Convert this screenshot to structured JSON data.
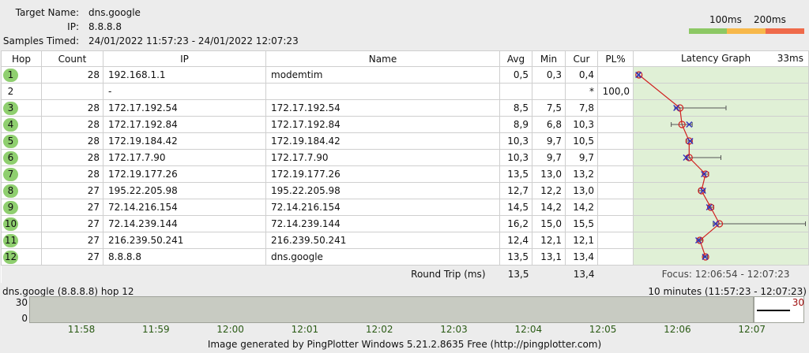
{
  "header": {
    "target_label": "Target Name:",
    "target_value": "dns.google",
    "ip_label": "IP:",
    "ip_value": "8.8.8.8",
    "samples_label": "Samples Timed:",
    "samples_value": "24/01/2022 11:57:23 - 24/01/2022 12:07:23"
  },
  "scale": {
    "label_100": "100ms",
    "label_200": "200ms",
    "colors": [
      "#8cc864",
      "#f7b84a",
      "#ef6a4a"
    ]
  },
  "columns": {
    "hop": "Hop",
    "count": "Count",
    "ip": "IP",
    "name": "Name",
    "avg": "Avg",
    "min": "Min",
    "cur": "Cur",
    "pl": "PL%",
    "graph": "Latency Graph",
    "graph_max": "33ms"
  },
  "graph": {
    "max_ms": 33,
    "line_color": "#d02020",
    "marker_color": "#3030c0"
  },
  "hops": [
    {
      "hop": "1",
      "count": "28",
      "ip": "192.168.1.1",
      "name": "modemtim",
      "avg": "0,5",
      "min": "0,3",
      "cur": "0,4",
      "pl": "",
      "avg_ms": 0.5,
      "min_ms": 0.3,
      "max_ms": 0.6,
      "cur_ms": 0.4
    },
    {
      "hop": "2",
      "count": "",
      "ip": "-",
      "name": "",
      "avg": "",
      "min": "",
      "cur": "*",
      "pl": "100,0",
      "avg_ms": null,
      "min_ms": null,
      "max_ms": null,
      "cur_ms": null
    },
    {
      "hop": "3",
      "count": "28",
      "ip": "172.17.192.54",
      "name": "172.17.192.54",
      "avg": "8,5",
      "min": "7,5",
      "cur": "7,8",
      "pl": "",
      "avg_ms": 8.5,
      "min_ms": 7.5,
      "max_ms": 17.5,
      "cur_ms": 7.8
    },
    {
      "hop": "4",
      "count": "28",
      "ip": "172.17.192.84",
      "name": "172.17.192.84",
      "avg": "8,9",
      "min": "6,8",
      "cur": "10,3",
      "pl": "",
      "avg_ms": 8.9,
      "min_ms": 6.8,
      "max_ms": 10.9,
      "cur_ms": 10.3
    },
    {
      "hop": "5",
      "count": "28",
      "ip": "172.19.184.42",
      "name": "172.19.184.42",
      "avg": "10,3",
      "min": "9,7",
      "cur": "10,5",
      "pl": "",
      "avg_ms": 10.3,
      "min_ms": 9.7,
      "max_ms": 10.9,
      "cur_ms": 10.5
    },
    {
      "hop": "6",
      "count": "28",
      "ip": "172.17.7.90",
      "name": "172.17.7.90",
      "avg": "10,3",
      "min": "9,7",
      "cur": "9,7",
      "pl": "",
      "avg_ms": 10.3,
      "min_ms": 9.7,
      "max_ms": 16.5,
      "cur_ms": 9.7
    },
    {
      "hop": "7",
      "count": "28",
      "ip": "172.19.177.26",
      "name": "172.19.177.26",
      "avg": "13,5",
      "min": "13,0",
      "cur": "13,2",
      "pl": "",
      "avg_ms": 13.5,
      "min_ms": 13.0,
      "max_ms": 14.1,
      "cur_ms": 13.2
    },
    {
      "hop": "8",
      "count": "27",
      "ip": "195.22.205.98",
      "name": "195.22.205.98",
      "avg": "12,7",
      "min": "12,2",
      "cur": "13,0",
      "pl": "",
      "avg_ms": 12.7,
      "min_ms": 12.2,
      "max_ms": 13.4,
      "cur_ms": 13.0
    },
    {
      "hop": "9",
      "count": "27",
      "ip": "72.14.216.154",
      "name": "72.14.216.154",
      "avg": "14,5",
      "min": "14,2",
      "cur": "14,2",
      "pl": "",
      "avg_ms": 14.5,
      "min_ms": 14.2,
      "max_ms": 15.1,
      "cur_ms": 14.2
    },
    {
      "hop": "10",
      "count": "27",
      "ip": "72.14.239.144",
      "name": "72.14.239.144",
      "avg": "16,2",
      "min": "15,0",
      "cur": "15,5",
      "pl": "",
      "avg_ms": 16.2,
      "min_ms": 15.0,
      "max_ms": 33.0,
      "cur_ms": 15.5
    },
    {
      "hop": "11",
      "count": "27",
      "ip": "216.239.50.241",
      "name": "216.239.50.241",
      "avg": "12,4",
      "min": "12,1",
      "cur": "12,1",
      "pl": "",
      "avg_ms": 12.4,
      "min_ms": 12.1,
      "max_ms": 12.9,
      "cur_ms": 12.1
    },
    {
      "hop": "12",
      "count": "27",
      "ip": "8.8.8.8",
      "name": "dns.google",
      "avg": "13,5",
      "min": "13,1",
      "cur": "13,4",
      "pl": "",
      "avg_ms": 13.5,
      "min_ms": 13.1,
      "max_ms": 13.9,
      "cur_ms": 13.4
    }
  ],
  "round_trip": {
    "label": "Round Trip (ms)",
    "avg": "13,5",
    "cur": "13,4",
    "focus": "Focus: 12:06:54 - 12:07:23"
  },
  "timeline": {
    "title": "dns.google (8.8.8.8) hop 12",
    "range": "10 minutes (11:57:23 - 12:07:23)",
    "y_top": "30",
    "y_bottom": "0",
    "right_value": "30",
    "ticks": [
      "11:58",
      "11:59",
      "12:00",
      "12:01",
      "12:02",
      "12:03",
      "12:04",
      "12:05",
      "12:06",
      "12:07"
    ]
  },
  "footer": "Image generated by PingPlotter Windows 5.21.2.8635 Free (http://pingplotter.com)"
}
